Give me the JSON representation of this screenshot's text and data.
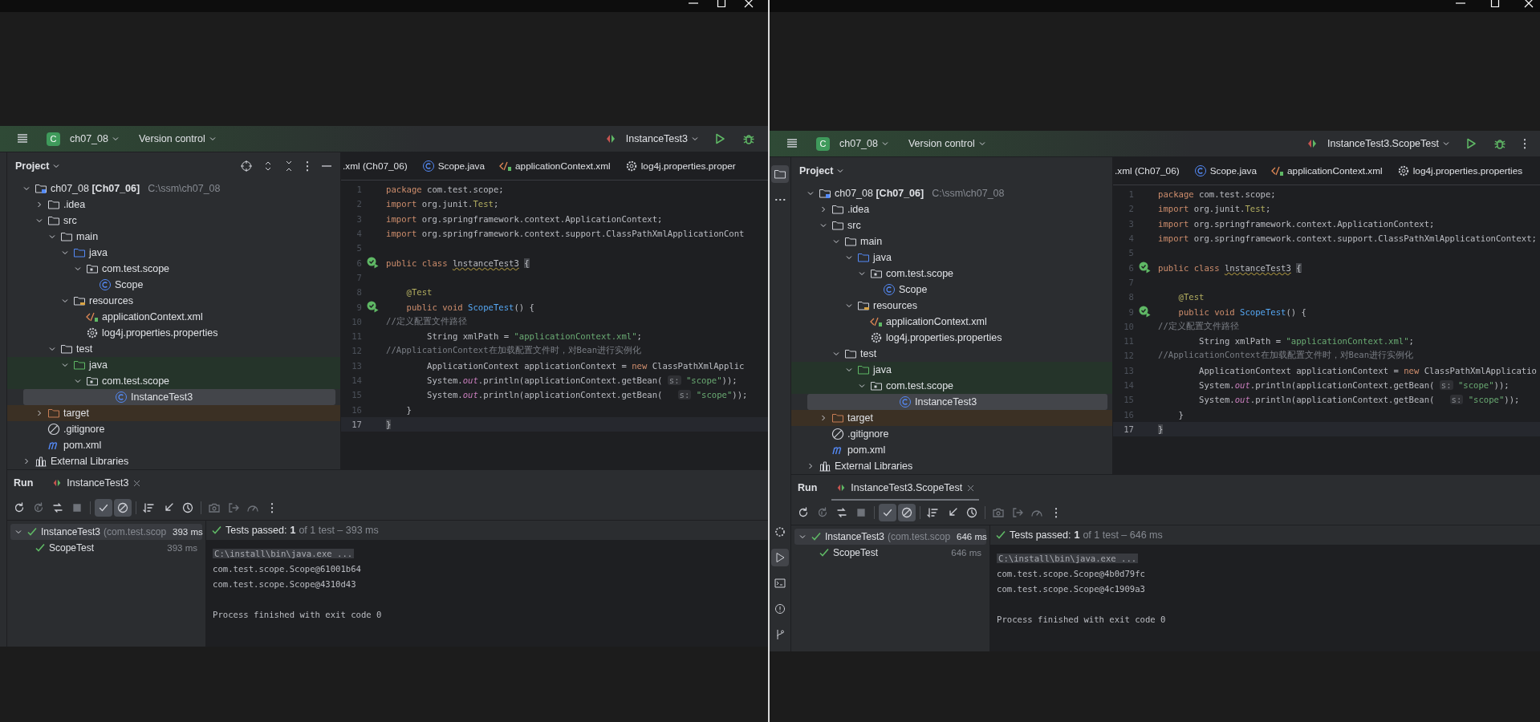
{
  "windows": [
    {
      "project": {
        "badge": "C",
        "name": "ch07_08"
      },
      "vcs": "Version control",
      "run_config": "InstanceTest3",
      "show_more_action": false,
      "tool_strip_expanded": false,
      "project_panel": {
        "title": "Project",
        "show_actions": true,
        "tree": [
          {
            "label": "ch07_08 **[Ch07_06]**",
            "path": "C:\\ssm\\ch07_08",
            "kind": "module",
            "expanded": true,
            "selected": false,
            "children": [
              {
                "label": ".idea",
                "kind": "folder",
                "expanded": false,
                "selected": false
              },
              {
                "label": "src",
                "kind": "folder",
                "expanded": true,
                "selected": false,
                "children": [
                  {
                    "label": "main",
                    "kind": "folder",
                    "expanded": true,
                    "selected": false,
                    "children": [
                      {
                        "label": "java",
                        "kind": "source",
                        "expanded": true,
                        "selected": false,
                        "children": [
                          {
                            "label": "com.test.scope",
                            "kind": "package",
                            "expanded": true,
                            "selected": false,
                            "children": [
                              {
                                "label": "Scope",
                                "kind": "class",
                                "selected": false
                              }
                            ]
                          }
                        ]
                      },
                      {
                        "label": "resources",
                        "kind": "resources",
                        "expanded": true,
                        "selected": false,
                        "children": [
                          {
                            "label": "applicationContext.xml",
                            "kind": "xml",
                            "selected": false
                          },
                          {
                            "label": "log4j.properties.properties",
                            "kind": "properties",
                            "selected": false
                          }
                        ]
                      }
                    ]
                  },
                  {
                    "label": "test",
                    "kind": "folder",
                    "expanded": true,
                    "selected": false,
                    "children": [
                      {
                        "label": "java",
                        "kind": "test-source",
                        "expanded": true,
                        "selected": false,
                        "color": "#25342a",
                        "children": [
                          {
                            "label": "com.test.scope",
                            "kind": "package",
                            "expanded": true,
                            "selected": false,
                            "color": "#25342a",
                            "children": [
                              {
                                "label": "InstanceTest3",
                                "kind": "class",
                                "selected": true
                              }
                            ]
                          }
                        ]
                      }
                    ]
                  }
                ]
              },
              {
                "label": "target",
                "kind": "excluded",
                "expanded": false,
                "selected": false,
                "color": "#3b3024"
              },
              {
                "label": ".gitignore",
                "kind": "ignore",
                "selected": false
              },
              {
                "label": "pom.xml",
                "kind": "maven",
                "selected": false
              }
            ]
          },
          {
            "label": "External Libraries",
            "kind": "libraries",
            "expanded": false,
            "selected": false
          }
        ]
      },
      "editor": {
        "tabs": [
          {
            "label": ".xml (Ch07_06)",
            "kind": "plain",
            "selected": false
          },
          {
            "label": "Scope.java",
            "kind": "class",
            "selected": false
          },
          {
            "label": "applicationContext.xml",
            "kind": "xml",
            "selected": false
          },
          {
            "label": "log4j.properties.proper",
            "kind": "properties",
            "selected": false
          }
        ],
        "lines": [
          {
            "number": "1",
            "current": false,
            "tokens": [
              {
                "kind": "keyword",
                "text": "package"
              },
              {
                "kind": "plain",
                "text": " com.test.scope;"
              }
            ]
          },
          {
            "number": "2",
            "current": false,
            "tokens": [
              {
                "kind": "keyword",
                "text": "import"
              },
              {
                "kind": "plain",
                "text": " org.junit."
              },
              {
                "kind": "annotation",
                "text": "Test"
              },
              {
                "kind": "plain",
                "text": ";"
              }
            ]
          },
          {
            "number": "3",
            "current": false,
            "tokens": [
              {
                "kind": "keyword",
                "text": "import"
              },
              {
                "kind": "plain",
                "text": " org.springframework.context.ApplicationContext;"
              }
            ]
          },
          {
            "number": "4",
            "current": false,
            "tokens": [
              {
                "kind": "keyword",
                "text": "import"
              },
              {
                "kind": "plain",
                "text": " org.springframework.context.support.ClassPathXmlApplicationCont"
              }
            ]
          },
          {
            "number": "5",
            "current": false
          },
          {
            "number": "6",
            "current": false,
            "run_marker": true,
            "tokens": [
              {
                "kind": "keyword",
                "text": "public class "
              },
              {
                "kind": "warning",
                "text": "lnstanceTest3"
              },
              {
                "kind": "brace",
                "text": "{"
              }
            ]
          },
          {
            "number": "7",
            "current": false
          },
          {
            "number": "8",
            "current": false,
            "tokens": [
              {
                "kind": "annotation",
                "text": "    @Test"
              }
            ]
          },
          {
            "number": "9",
            "current": false,
            "run_marker": true,
            "tokens": [
              {
                "kind": "keyword",
                "text": "    public void "
              },
              {
                "kind": "method",
                "text": "ScopeTest"
              },
              {
                "kind": "plain",
                "text": "() {"
              }
            ]
          },
          {
            "number": "10",
            "current": false,
            "tokens": [
              {
                "kind": "comment",
                "text": "//定义配置文件路径"
              }
            ]
          },
          {
            "number": "11",
            "current": false,
            "tokens": [
              {
                "kind": "plain",
                "text": "        String xmlPath = "
              },
              {
                "kind": "string",
                "text": "\"applicationContext.xml\""
              },
              {
                "kind": "plain",
                "text": ";"
              }
            ]
          },
          {
            "number": "12",
            "current": false,
            "tokens": [
              {
                "kind": "comment",
                "text": "//ApplicationContext在加载配置文件时，对Bean进行实例化"
              }
            ]
          },
          {
            "number": "13",
            "current": false,
            "tokens": [
              {
                "kind": "plain",
                "text": "        ApplicationContext applicationContext = "
              },
              {
                "kind": "keyword",
                "text": "new"
              },
              {
                "kind": "plain",
                "text": " ClassPathXmlApplic"
              }
            ]
          },
          {
            "number": "14",
            "current": false,
            "tokens": [
              {
                "kind": "plain",
                "text": "        System."
              },
              {
                "kind": "static",
                "text": "out"
              },
              {
                "kind": "plain",
                "text": ".println(applicationContext.getBean( "
              },
              {
                "kind": "hint",
                "text": "s:"
              },
              {
                "kind": "string",
                "text": " \"scope\""
              },
              {
                "kind": "plain",
                "text": "));"
              }
            ]
          },
          {
            "number": "15",
            "current": false,
            "tokens": [
              {
                "kind": "plain",
                "text": "        System."
              },
              {
                "kind": "static",
                "text": "out"
              },
              {
                "kind": "plain",
                "text": ".println(applicationContext.getBean(   "
              },
              {
                "kind": "hint",
                "text": "s:"
              },
              {
                "kind": "string",
                "text": " \"scope\""
              },
              {
                "kind": "plain",
                "text": "));"
              }
            ]
          },
          {
            "number": "16",
            "current": false,
            "tokens": [
              {
                "kind": "plain",
                "text": "    }"
              }
            ]
          },
          {
            "number": "17",
            "current": true,
            "tokens": [
              {
                "kind": "brace",
                "text": "}"
              }
            ]
          }
        ]
      },
      "run_panel": {
        "title": "Run",
        "tab": {
          "label": "InstanceTest3",
          "selected": false
        },
        "toolbar": [
          {
            "kind": "rerun",
            "selected": false,
            "disabled": false
          },
          {
            "kind": "rerun-failed",
            "selected": false,
            "disabled": true
          },
          {
            "kind": "toggle-auto",
            "selected": false,
            "disabled": false
          },
          {
            "kind": "stop",
            "selected": false,
            "disabled": true
          },
          {
            "kind": "show-passed",
            "selected": true,
            "disabled": false
          },
          {
            "kind": "show-ignored",
            "selected": true,
            "disabled": false
          },
          {
            "kind": "sort",
            "selected": false,
            "disabled": false
          },
          {
            "kind": "import",
            "selected": false,
            "disabled": false
          },
          {
            "kind": "history",
            "selected": false,
            "disabled": false
          },
          {
            "kind": "screenshot",
            "selected": false,
            "disabled": true
          },
          {
            "kind": "export",
            "selected": false,
            "disabled": true
          },
          {
            "kind": "coverage",
            "selected": false,
            "disabled": true
          },
          {
            "kind": "more",
            "selected": false,
            "disabled": false
          }
        ],
        "tests": [
          {
            "label": "InstanceTest3",
            "detail": "(com.test.scop",
            "time": "393 ms",
            "passed": true,
            "expanded": true,
            "selected": true,
            "children": [
              {
                "label": "ScopeTest",
                "time": "393 ms",
                "passed": true,
                "selected": false
              }
            ]
          }
        ],
        "summary": {
          "label": "Tests passed:",
          "count": "1",
          "detail": "of 1 test – 393 ms",
          "passed": true
        },
        "console": [
          {
            "kind": "command",
            "text": "C:\\install\\bin\\java.exe ..."
          },
          {
            "kind": "output",
            "text": "com.test.scope.Scope@61001b64"
          },
          {
            "kind": "output",
            "text": "com.test.scope.Scope@4310d43"
          },
          {
            "kind": "blank"
          },
          {
            "kind": "output",
            "text": "Process finished with exit code 0"
          }
        ]
      }
    },
    {
      "project": {
        "badge": "C",
        "name": "ch07_08"
      },
      "vcs": "Version control",
      "run_config": "InstanceTest3.ScopeTest",
      "show_more_action": true,
      "tool_strip_expanded": true,
      "project_panel": {
        "title": "Project",
        "show_actions": false,
        "tree": [
          {
            "label": "ch07_08 **[Ch07_06]**",
            "path": "C:\\ssm\\ch07_08",
            "kind": "module",
            "expanded": true,
            "selected": false,
            "children": [
              {
                "label": ".idea",
                "kind": "folder",
                "expanded": false,
                "selected": false
              },
              {
                "label": "src",
                "kind": "folder",
                "expanded": true,
                "selected": false,
                "children": [
                  {
                    "label": "main",
                    "kind": "folder",
                    "expanded": true,
                    "selected": false,
                    "children": [
                      {
                        "label": "java",
                        "kind": "source",
                        "expanded": true,
                        "selected": false,
                        "children": [
                          {
                            "label": "com.test.scope",
                            "kind": "package",
                            "expanded": true,
                            "selected": false,
                            "children": [
                              {
                                "label": "Scope",
                                "kind": "class",
                                "selected": false
                              }
                            ]
                          }
                        ]
                      },
                      {
                        "label": "resources",
                        "kind": "resources",
                        "expanded": true,
                        "selected": false,
                        "children": [
                          {
                            "label": "applicationContext.xml",
                            "kind": "xml",
                            "selected": false
                          },
                          {
                            "label": "log4j.properties.properties",
                            "kind": "properties",
                            "selected": false
                          }
                        ]
                      }
                    ]
                  },
                  {
                    "label": "test",
                    "kind": "folder",
                    "expanded": true,
                    "selected": false,
                    "children": [
                      {
                        "label": "java",
                        "kind": "test-source",
                        "expanded": true,
                        "selected": false,
                        "color": "#25342a",
                        "children": [
                          {
                            "label": "com.test.scope",
                            "kind": "package",
                            "expanded": true,
                            "selected": false,
                            "color": "#25342a",
                            "children": [
                              {
                                "label": "InstanceTest3",
                                "kind": "class",
                                "selected": true
                              }
                            ]
                          }
                        ]
                      }
                    ]
                  }
                ]
              },
              {
                "label": "target",
                "kind": "excluded",
                "expanded": false,
                "selected": false,
                "color": "#3b3024"
              },
              {
                "label": ".gitignore",
                "kind": "ignore",
                "selected": false
              },
              {
                "label": "pom.xml",
                "kind": "maven",
                "selected": false
              }
            ]
          },
          {
            "label": "External Libraries",
            "kind": "libraries",
            "expanded": false,
            "selected": false
          }
        ]
      },
      "editor": {
        "tabs": [
          {
            "label": ".xml (Ch07_06)",
            "kind": "plain",
            "selected": false
          },
          {
            "label": "Scope.java",
            "kind": "class",
            "selected": false
          },
          {
            "label": "applicationContext.xml",
            "kind": "xml",
            "selected": false
          },
          {
            "label": "log4j.properties.properties",
            "kind": "properties",
            "selected": false
          }
        ],
        "lines": [
          {
            "number": "1",
            "current": false,
            "tokens": [
              {
                "kind": "keyword",
                "text": "package"
              },
              {
                "kind": "plain",
                "text": " com.test.scope;"
              }
            ]
          },
          {
            "number": "2",
            "current": false,
            "tokens": [
              {
                "kind": "keyword",
                "text": "import"
              },
              {
                "kind": "plain",
                "text": " org.junit."
              },
              {
                "kind": "annotation",
                "text": "Test"
              },
              {
                "kind": "plain",
                "text": ";"
              }
            ]
          },
          {
            "number": "3",
            "current": false,
            "tokens": [
              {
                "kind": "keyword",
                "text": "import"
              },
              {
                "kind": "plain",
                "text": " org.springframework.context.ApplicationContext;"
              }
            ]
          },
          {
            "number": "4",
            "current": false,
            "tokens": [
              {
                "kind": "keyword",
                "text": "import"
              },
              {
                "kind": "plain",
                "text": " org.springframework.context.support.ClassPathXmlApplicationContext;"
              }
            ]
          },
          {
            "number": "5",
            "current": false
          },
          {
            "number": "6",
            "current": false,
            "run_marker": true,
            "tokens": [
              {
                "kind": "keyword",
                "text": "public class "
              },
              {
                "kind": "warning",
                "text": "lnstanceTest3"
              },
              {
                "kind": "brace",
                "text": "{"
              }
            ]
          },
          {
            "number": "7",
            "current": false
          },
          {
            "number": "8",
            "current": false,
            "tokens": [
              {
                "kind": "annotation",
                "text": "    @Test"
              }
            ]
          },
          {
            "number": "9",
            "current": false,
            "run_marker": true,
            "tokens": [
              {
                "kind": "keyword",
                "text": "    public void "
              },
              {
                "kind": "method",
                "text": "ScopeTest"
              },
              {
                "kind": "plain",
                "text": "() {"
              }
            ]
          },
          {
            "number": "10",
            "current": false,
            "tokens": [
              {
                "kind": "comment",
                "text": "//定义配置文件路径"
              }
            ]
          },
          {
            "number": "11",
            "current": false,
            "tokens": [
              {
                "kind": "plain",
                "text": "        String xmlPath = "
              },
              {
                "kind": "string",
                "text": "\"applicationContext.xml\""
              },
              {
                "kind": "plain",
                "text": ";"
              }
            ]
          },
          {
            "number": "12",
            "current": false,
            "tokens": [
              {
                "kind": "comment",
                "text": "//ApplicationContext在加载配置文件时，对Bean进行实例化"
              }
            ]
          },
          {
            "number": "13",
            "current": false,
            "tokens": [
              {
                "kind": "plain",
                "text": "        ApplicationContext applicationContext = "
              },
              {
                "kind": "keyword",
                "text": "new"
              },
              {
                "kind": "plain",
                "text": " ClassPathXmlApplicatio"
              }
            ]
          },
          {
            "number": "14",
            "current": false,
            "tokens": [
              {
                "kind": "plain",
                "text": "        System."
              },
              {
                "kind": "static",
                "text": "out"
              },
              {
                "kind": "plain",
                "text": ".println(applicationContext.getBean( "
              },
              {
                "kind": "hint",
                "text": "s:"
              },
              {
                "kind": "string",
                "text": " \"scope\""
              },
              {
                "kind": "plain",
                "text": "));"
              }
            ]
          },
          {
            "number": "15",
            "current": false,
            "tokens": [
              {
                "kind": "plain",
                "text": "        System."
              },
              {
                "kind": "static",
                "text": "out"
              },
              {
                "kind": "plain",
                "text": ".println(applicationContext.getBean(   "
              },
              {
                "kind": "hint",
                "text": "s:"
              },
              {
                "kind": "string",
                "text": " \"scope\""
              },
              {
                "kind": "plain",
                "text": "));"
              }
            ]
          },
          {
            "number": "16",
            "current": false,
            "tokens": [
              {
                "kind": "plain",
                "text": "    }"
              }
            ]
          },
          {
            "number": "17",
            "current": true,
            "tokens": [
              {
                "kind": "brace",
                "text": "}"
              }
            ]
          }
        ]
      },
      "run_panel": {
        "title": "Run",
        "tab": {
          "label": "InstanceTest3.ScopeTest",
          "selected": true
        },
        "toolbar": [
          {
            "kind": "rerun",
            "selected": false,
            "disabled": false
          },
          {
            "kind": "rerun-failed",
            "selected": false,
            "disabled": true
          },
          {
            "kind": "toggle-auto",
            "selected": false,
            "disabled": false
          },
          {
            "kind": "stop",
            "selected": false,
            "disabled": true
          },
          {
            "kind": "show-passed",
            "selected": true,
            "disabled": false
          },
          {
            "kind": "show-ignored",
            "selected": true,
            "disabled": false
          },
          {
            "kind": "sort",
            "selected": false,
            "disabled": false
          },
          {
            "kind": "import",
            "selected": false,
            "disabled": false
          },
          {
            "kind": "history",
            "selected": false,
            "disabled": false
          },
          {
            "kind": "screenshot",
            "selected": false,
            "disabled": true
          },
          {
            "kind": "export",
            "selected": false,
            "disabled": true
          },
          {
            "kind": "coverage",
            "selected": false,
            "disabled": true
          },
          {
            "kind": "more",
            "selected": false,
            "disabled": false
          }
        ],
        "tests": [
          {
            "label": "InstanceTest3",
            "detail": "(com.test.scop",
            "time": "646 ms",
            "passed": true,
            "expanded": true,
            "selected": true,
            "children": [
              {
                "label": "ScopeTest",
                "time": "646 ms",
                "passed": true,
                "selected": false
              }
            ]
          }
        ],
        "summary": {
          "label": "Tests passed:",
          "count": "1",
          "detail": "of 1 test – 646 ms",
          "passed": true
        },
        "console": [
          {
            "kind": "command",
            "text": "C:\\install\\bin\\java.exe ..."
          },
          {
            "kind": "output",
            "text": "com.test.scope.Scope@4b0d79fc"
          },
          {
            "kind": "output",
            "text": "com.test.scope.Scope@4c1909a3"
          },
          {
            "kind": "blank"
          },
          {
            "kind": "output",
            "text": "Process finished with exit code 0"
          }
        ]
      }
    }
  ]
}
